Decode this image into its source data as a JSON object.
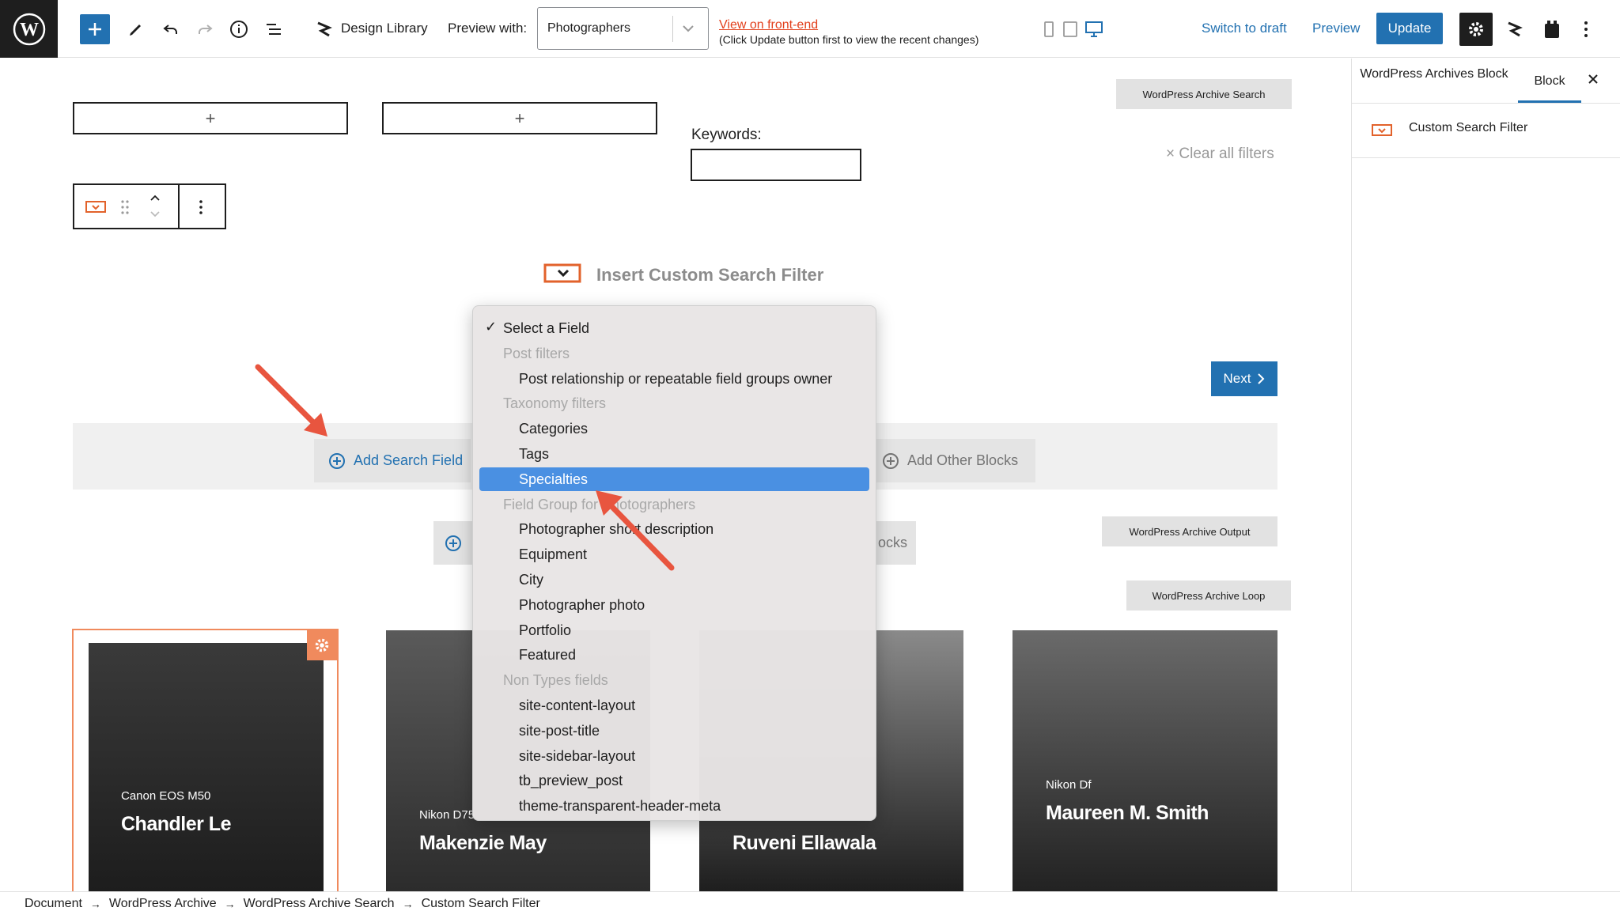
{
  "toolbar": {
    "design_library": "Design Library",
    "preview_with_label": "Preview with:",
    "preview_with_value": "Photographers",
    "view_front_end": "View on front-end",
    "view_front_end_note": "(Click Update button first to view the recent changes)",
    "switch_to_draft": "Switch to draft",
    "preview": "Preview",
    "update": "Update"
  },
  "canvas": {
    "archive_search_tag": "WordPress Archive Search",
    "keywords_label": "Keywords:",
    "clear_filters": "× Clear all filters",
    "insert_title": "Insert Custom Search Filter",
    "next_label": "Next",
    "add_search_field": "Add Search Field",
    "add_other_blocks": "Add Other Blocks",
    "row2_fragment": "ocks",
    "archive_output_tag": "WordPress Archive Output",
    "archive_loop_tag": "WordPress Archive Loop",
    "cards": [
      {
        "camera": "Canon EOS M50",
        "name": "Chandler Le"
      },
      {
        "camera": "Nikon D75",
        "name": "Makenzie May"
      },
      {
        "camera": "",
        "name": "Ruveni Ellawala"
      },
      {
        "camera": "Nikon Df",
        "name": "Maureen M. Smith"
      }
    ]
  },
  "dropdown": {
    "items": [
      {
        "label": "Select a Field",
        "type": "checked"
      },
      {
        "label": "Post filters",
        "type": "group"
      },
      {
        "label": "Post relationship or repeatable field groups owner",
        "type": "option"
      },
      {
        "label": "Taxonomy filters",
        "type": "group"
      },
      {
        "label": "Categories",
        "type": "option"
      },
      {
        "label": "Tags",
        "type": "option"
      },
      {
        "label": "Specialties",
        "type": "selected"
      },
      {
        "label": "Field Group for Photographers",
        "type": "group"
      },
      {
        "label": "Photographer short description",
        "type": "option"
      },
      {
        "label": "Equipment",
        "type": "option"
      },
      {
        "label": "City",
        "type": "option"
      },
      {
        "label": "Photographer photo",
        "type": "option"
      },
      {
        "label": "Portfolio",
        "type": "option"
      },
      {
        "label": "Featured",
        "type": "option"
      },
      {
        "label": "Non Types fields",
        "type": "group"
      },
      {
        "label": "site-content-layout",
        "type": "option"
      },
      {
        "label": "site-post-title",
        "type": "option"
      },
      {
        "label": "site-sidebar-layout",
        "type": "option"
      },
      {
        "label": "tb_preview_post",
        "type": "option"
      },
      {
        "label": "theme-transparent-header-meta",
        "type": "option"
      }
    ]
  },
  "sidebar": {
    "tab_archive": "WordPress Archives Block",
    "tab_block": "Block",
    "block_name": "Custom Search Filter"
  },
  "breadcrumb": [
    "Document",
    "WordPress Archive",
    "WordPress Archive Search",
    "Custom Search Filter"
  ],
  "colors": {
    "accent": "#2271b1",
    "highlight": "#4a90e2",
    "orange": "#f08a5d",
    "red_link": "#e2401c"
  }
}
